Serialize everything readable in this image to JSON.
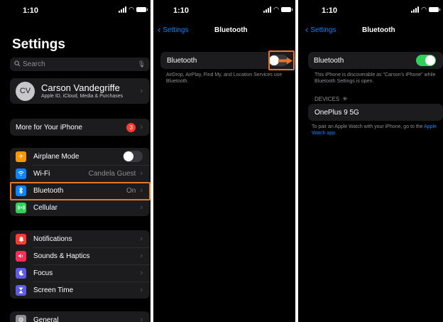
{
  "settings_panel": {
    "status": {
      "time": "1:10"
    },
    "title": "Settings",
    "search_placeholder": "Search",
    "profile": {
      "initials": "CV",
      "name": "Carson Vandegriffe",
      "subtitle": "Apple ID, iCloud, Media & Purchases"
    },
    "more": {
      "label": "More for Your iPhone",
      "badge": "3"
    },
    "connectivity": [
      {
        "label": "Airplane Mode",
        "icon": "airplane-icon",
        "color": "#ff9500"
      },
      {
        "label": "Wi-Fi",
        "value": "Candela Guest",
        "icon": "wifi-icon",
        "color": "#0a84ff"
      },
      {
        "label": "Bluetooth",
        "value": "On",
        "icon": "bluetooth-icon",
        "color": "#0a84ff"
      },
      {
        "label": "Cellular",
        "icon": "cellular-icon",
        "color": "#30d158"
      }
    ],
    "alerts": [
      {
        "label": "Notifications",
        "icon": "bell-icon",
        "color": "#ff3b30"
      },
      {
        "label": "Sounds & Haptics",
        "icon": "speaker-icon",
        "color": "#ff2d55"
      },
      {
        "label": "Focus",
        "icon": "moon-icon",
        "color": "#5e5ce6"
      },
      {
        "label": "Screen Time",
        "icon": "hourglass-icon",
        "color": "#5e5ce6"
      }
    ],
    "general": {
      "label": "General",
      "icon": "gear-icon",
      "color": "#8e8e93"
    }
  },
  "bluetooth_off_panel": {
    "status": {
      "time": "1:10"
    },
    "back_label": "Settings",
    "title": "Bluetooth",
    "toggle_label": "Bluetooth",
    "toggle_on": false,
    "note": "AirDrop, AirPlay, Find My, and Location Services use Bluetooth."
  },
  "bluetooth_on_panel": {
    "status": {
      "time": "1:10"
    },
    "back_label": "Settings",
    "title": "Bluetooth",
    "toggle_label": "Bluetooth",
    "toggle_on": true,
    "note": "This iPhone is discoverable as \"Carson's iPhone\" while Bluetooth Settings is open.",
    "devices_header": "DEVICES",
    "device": "OnePlus 9 5G",
    "watch_note": "To pair an Apple Watch with your iPhone, go to the",
    "watch_link": "Apple Watch app."
  },
  "colors": {
    "accent": "#0a84ff",
    "highlight": "#e2762d",
    "toggle_on": "#30d158"
  }
}
